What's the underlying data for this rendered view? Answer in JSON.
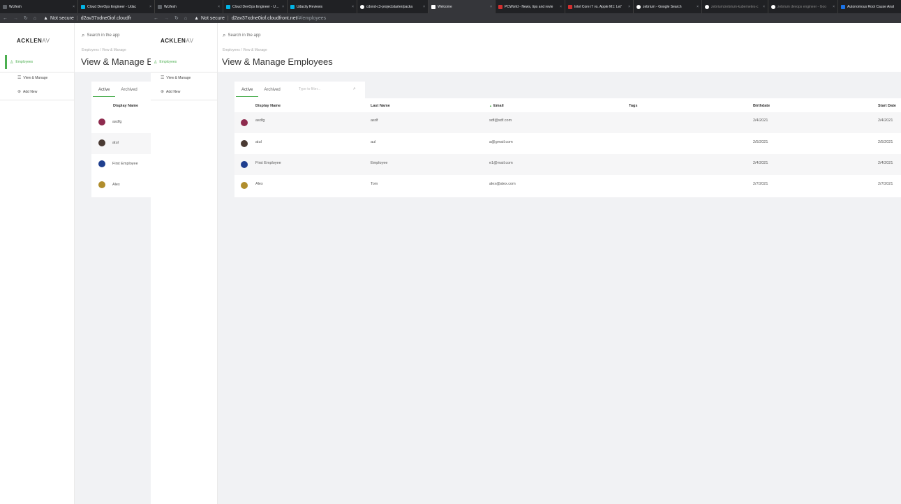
{
  "browser": {
    "tabs": [
      {
        "title": "Wcifesh",
        "color": "#5f6368"
      },
      {
        "title": "Cloud DevOps Engineer - Udac",
        "color": "#02b3e4"
      },
      {
        "title": "Wcifesh",
        "color": "#5f6368"
      },
      {
        "title": "Cloud DevOps Engineer - Udac",
        "color": "#02b3e4"
      },
      {
        "title": "Udacity Reviews",
        "color": "#02b3e4"
      },
      {
        "title": "cdond-c3-projectstarter/packa",
        "color": "#ffffff"
      },
      {
        "title": "Welcome",
        "color": "#ffffff"
      },
      {
        "title": "PCWorld - News, tips and revie",
        "color": "#d32f2f"
      },
      {
        "title": "Intel Core i7 vs. Apple M1: Let'",
        "color": "#d32f2f"
      },
      {
        "title": "zebrium - Google Search",
        "color": "#ffffff"
      },
      {
        "title": "zebrium/zebrium-kubernetes-c",
        "color": "#ffffff"
      },
      {
        "title": "zebrium devops engineer - Goo",
        "color": "#ffffff"
      },
      {
        "title": "Autonomous Root Cause Anal",
        "color": "#1a73e8"
      }
    ],
    "address_left": {
      "security": "Not secure",
      "url": "d2av37xdne0iof.cloudfr"
    },
    "address_right": {
      "security": "Not secure",
      "url": "d2av37xdne0iof.cloudfront.net",
      "path": "/#/employees"
    }
  },
  "app": {
    "logo_main": "ACKLEN",
    "logo_suffix": "AV",
    "search_placeholder": "Search in the app",
    "breadcrumb": "Employees  /  View & Manage",
    "title": "View & Manage Employees",
    "title_truncated": "View & Manage Em",
    "sidebar": {
      "employees": "Employees",
      "view_manage": "View & Manage",
      "add_new": "Add New"
    },
    "tabs": {
      "active": "Active",
      "archived": "Archived"
    },
    "filter_placeholder": "Type to filter...",
    "columns": {
      "display_name": "Display Name",
      "last_name": "Last Name",
      "email": "Email",
      "tags": "Tags",
      "birthdate": "Birthdate",
      "start_date": "Start Date"
    },
    "sort_indicator": "▲",
    "rows": [
      {
        "display_name": "asdfg",
        "last_name": "asdf",
        "email": "sdf@sdf.com",
        "tags": "",
        "birthdate": "2/4/2021",
        "start_date": "2/4/2021",
        "avatar_color": "#8e2b4e"
      },
      {
        "display_name": "atul",
        "last_name": "aul",
        "email": "a@gmail.com",
        "tags": "",
        "birthdate": "2/5/2021",
        "start_date": "2/5/2021",
        "avatar_color": "#4a3a33"
      },
      {
        "display_name": "First Employee",
        "last_name": "Employee",
        "email": "e1@mail.com",
        "tags": "",
        "birthdate": "2/4/2021",
        "start_date": "2/4/2021",
        "avatar_color": "#1f3f8f"
      },
      {
        "display_name": "Alex",
        "last_name": "Tom",
        "email": "alex@alex.com",
        "tags": "",
        "birthdate": "2/7/2021",
        "start_date": "2/7/2021",
        "avatar_color": "#b08d2c"
      }
    ]
  }
}
